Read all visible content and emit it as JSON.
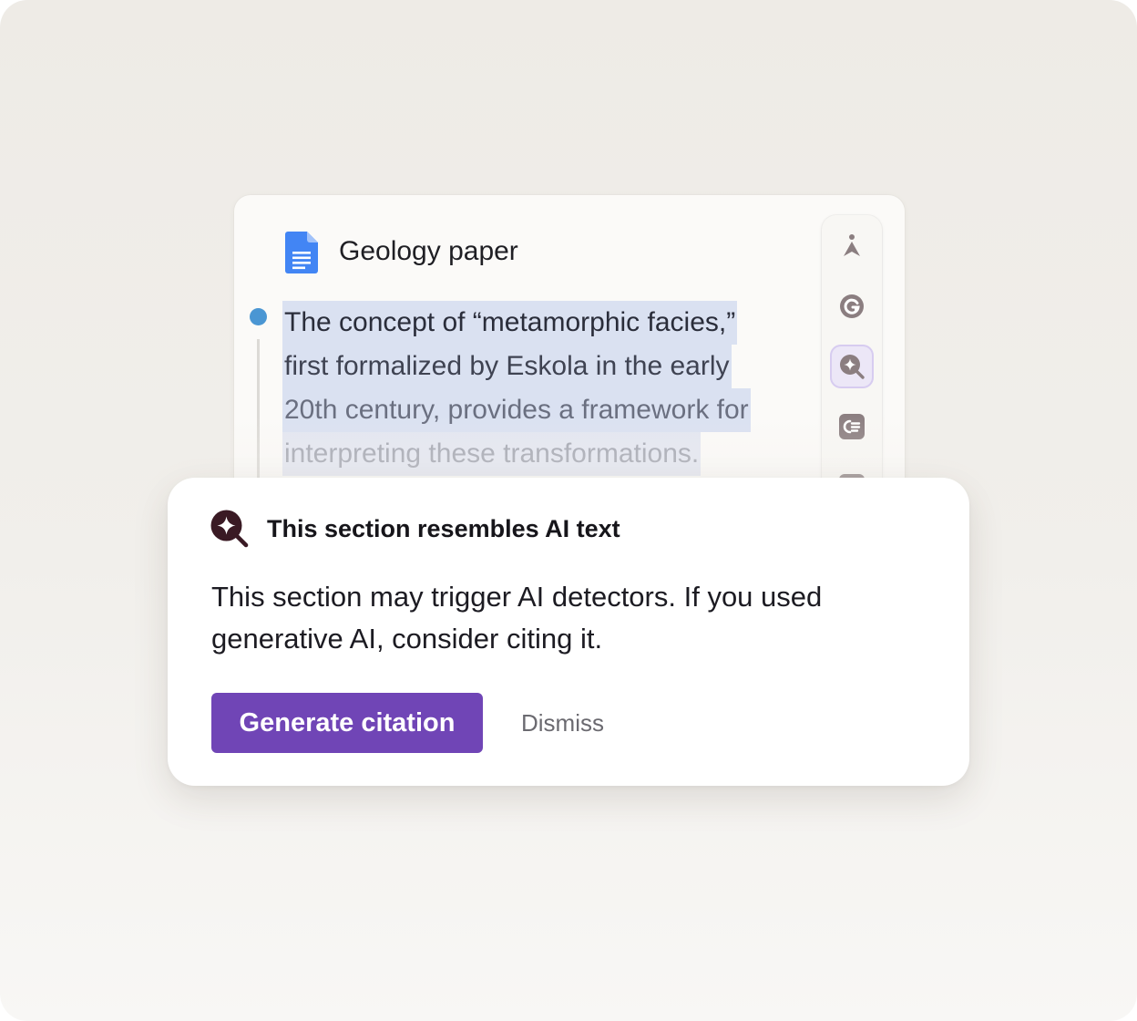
{
  "document": {
    "title": "Geology paper",
    "icon": "google-docs-icon",
    "passage_lines": [
      "The concept of “metamorphic facies,”",
      "first formalized by Eskola in the early",
      "20th century, provides a framework for",
      "interpreting these transformations."
    ]
  },
  "toolbar": {
    "items": [
      {
        "icon": "compass-pen-icon",
        "active": false
      },
      {
        "icon": "grammarly-g-icon",
        "active": false
      },
      {
        "icon": "ai-detector-search-icon",
        "active": true
      },
      {
        "icon": "citation-list-icon",
        "active": false
      },
      {
        "icon": "more-tools-icon",
        "active": false
      }
    ]
  },
  "popup": {
    "icon": "ai-detector-search-icon",
    "title": "This section resembles AI text",
    "body": "This section may trigger AI detectors. If you used generative AI, consider citing it.",
    "primary_button": "Generate citation",
    "secondary_button": "Dismiss"
  },
  "colors": {
    "accent": "#7045b6",
    "highlight": "#dae1f1",
    "bullet": "#4a96d3",
    "toolbar_icon": "#8b7e80",
    "popup_icon": "#3a1a24"
  }
}
